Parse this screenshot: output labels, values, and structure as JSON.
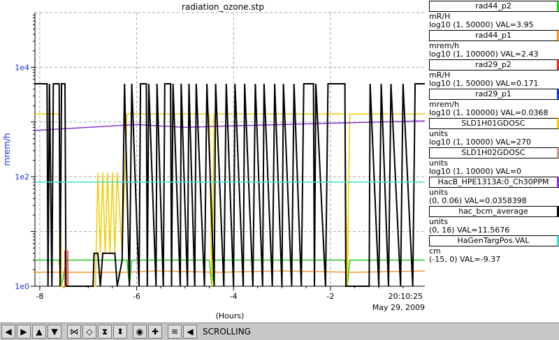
{
  "chart_data": {
    "type": "line",
    "title": "radiation_ozone.stp",
    "ylabel": "mrem/h",
    "xlabel": "(Hours)",
    "y_scale": "log",
    "ylim": [
      1,
      100000
    ],
    "xlim": [
      -8.1,
      -0.05
    ],
    "x_ticks": [
      -8,
      -6,
      -4,
      -2
    ],
    "y_ticks": [
      {
        "v": 1,
        "label": "1e0"
      },
      {
        "v": 100,
        "label": "1e2"
      },
      {
        "v": 10000,
        "label": "1e4"
      }
    ],
    "x_end_time": "20:10:25",
    "x_end_date": "May 29, 2009",
    "grid": true,
    "series": [
      {
        "name": "rad44_p2",
        "color": "#22cc22",
        "points": [
          [
            -8.1,
            3
          ],
          [
            -7.6,
            3
          ],
          [
            -7.55,
            1
          ],
          [
            -7.45,
            3
          ],
          [
            -6.2,
            3
          ],
          [
            -6.15,
            1
          ],
          [
            -6.1,
            3
          ],
          [
            -4.5,
            3
          ],
          [
            -4.45,
            1
          ],
          [
            -4.4,
            3
          ],
          [
            -1.7,
            3
          ],
          [
            -1.65,
            1
          ],
          [
            -1.6,
            3
          ],
          [
            -0.05,
            3
          ]
        ]
      },
      {
        "name": "rad44_p1",
        "color": "#ee9933",
        "points": [
          [
            -8.1,
            1.8
          ],
          [
            -7.5,
            1.8
          ],
          [
            -6.2,
            1.8
          ],
          [
            -5.6,
            1.9
          ],
          [
            -4.3,
            1.8
          ],
          [
            -3.0,
            1.9
          ],
          [
            -1.5,
            1.8
          ],
          [
            -0.05,
            1.9
          ]
        ]
      },
      {
        "name": "rad29_p2",
        "color": "#ee2222",
        "points": [
          [
            -7.48,
            4.5
          ],
          [
            -7.48,
            1
          ],
          [
            -7.42,
            1
          ],
          [
            -7.42,
            4.5
          ]
        ]
      },
      {
        "name": "rad29_p1",
        "color": "#1a2ee0",
        "points": []
      },
      {
        "name": "SLD1H01GDOSC",
        "color": "#f5cc00",
        "points": [
          [
            -8.1,
            1400
          ],
          [
            -7.6,
            1400
          ],
          [
            -7.55,
            1
          ],
          [
            -7.45,
            1
          ],
          [
            -6.85,
            1
          ],
          [
            -6.8,
            120
          ],
          [
            -6.75,
            4
          ],
          [
            -6.7,
            120
          ],
          [
            -6.65,
            4
          ],
          [
            -6.6,
            120
          ],
          [
            -6.55,
            4
          ],
          [
            -6.5,
            120
          ],
          [
            -6.45,
            4
          ],
          [
            -6.4,
            120
          ],
          [
            -6.3,
            4
          ],
          [
            -6.2,
            1400
          ],
          [
            -4.5,
            1400
          ],
          [
            -4.45,
            1
          ],
          [
            -4.4,
            1400
          ],
          [
            -1.7,
            1400
          ],
          [
            -1.65,
            1
          ],
          [
            -1.6,
            1400
          ],
          [
            -0.05,
            1400
          ]
        ]
      },
      {
        "name": "SLD1H02GDOSC",
        "color": "#c09a90",
        "points": []
      },
      {
        "name": "HacB_HPE1313A:0_Ch30PPM",
        "color": "#8833dd",
        "points": [
          [
            -8.1,
            700
          ],
          [
            -7.0,
            800
          ],
          [
            -6.0,
            900
          ],
          [
            -5.0,
            800
          ],
          [
            -4.0,
            850
          ],
          [
            -3.0,
            900
          ],
          [
            -2.0,
            950
          ],
          [
            -1.0,
            1000
          ],
          [
            -0.05,
            1050
          ]
        ]
      },
      {
        "name": "hac_bcm_average",
        "color": "#000000",
        "points": [
          [
            -8.1,
            5000
          ],
          [
            -7.85,
            5000
          ],
          [
            -7.83,
            1
          ],
          [
            -7.8,
            5000
          ],
          [
            -7.75,
            1
          ],
          [
            -7.72,
            5000
          ],
          [
            -7.6,
            5000
          ],
          [
            -7.58,
            1
          ],
          [
            -7.55,
            5000
          ],
          [
            -7.48,
            5000
          ],
          [
            -7.46,
            1
          ],
          [
            -6.9,
            1
          ],
          [
            -6.88,
            4
          ],
          [
            -6.8,
            4
          ],
          [
            -6.75,
            1
          ],
          [
            -6.7,
            4
          ],
          [
            -6.45,
            4
          ],
          [
            -6.4,
            1
          ],
          [
            -6.3,
            3
          ],
          [
            -6.25,
            5000
          ],
          [
            -6.15,
            1
          ],
          [
            -6.1,
            5000
          ],
          [
            -5.95,
            1
          ],
          [
            -5.92,
            5000
          ],
          [
            -5.8,
            5000
          ],
          [
            -5.78,
            1
          ],
          [
            -5.75,
            5000
          ],
          [
            -5.6,
            1
          ],
          [
            -5.58,
            5000
          ],
          [
            -5.45,
            1
          ],
          [
            -5.42,
            5000
          ],
          [
            -5.3,
            5000
          ],
          [
            -5.28,
            1
          ],
          [
            -5.25,
            5000
          ],
          [
            -5.1,
            1
          ],
          [
            -5.08,
            5000
          ],
          [
            -4.95,
            1
          ],
          [
            -4.92,
            5000
          ],
          [
            -4.8,
            1
          ],
          [
            -4.77,
            5000
          ],
          [
            -4.6,
            1
          ],
          [
            -4.55,
            5000
          ],
          [
            -4.4,
            1
          ],
          [
            -4.37,
            5000
          ],
          [
            -4.2,
            1
          ],
          [
            -4.15,
            5000
          ],
          [
            -4.0,
            1
          ],
          [
            -3.97,
            5000
          ],
          [
            -3.8,
            1
          ],
          [
            -3.77,
            5000
          ],
          [
            -3.6,
            1
          ],
          [
            -3.55,
            5000
          ],
          [
            -3.4,
            1
          ],
          [
            -3.37,
            5000
          ],
          [
            -3.2,
            1
          ],
          [
            -3.15,
            5000
          ],
          [
            -3.0,
            1
          ],
          [
            -2.97,
            5000
          ],
          [
            -2.8,
            1
          ],
          [
            -2.75,
            5000
          ],
          [
            -2.6,
            1
          ],
          [
            -2.55,
            5000
          ],
          [
            -2.35,
            5000
          ],
          [
            -2.33,
            1
          ],
          [
            -2.3,
            5000
          ],
          [
            -2.1,
            1
          ],
          [
            -2.05,
            5000
          ],
          [
            -1.7,
            5000
          ],
          [
            -1.68,
            1
          ],
          [
            -1.2,
            1
          ],
          [
            -1.18,
            5000
          ],
          [
            -1.0,
            1
          ],
          [
            -0.95,
            5000
          ],
          [
            -0.8,
            1
          ],
          [
            -0.75,
            5000
          ],
          [
            -0.55,
            1
          ],
          [
            -0.5,
            5000
          ],
          [
            -0.3,
            1
          ],
          [
            -0.25,
            5000
          ],
          [
            -0.05,
            5000
          ]
        ]
      },
      {
        "name": "HaGenTargPos.VAL",
        "color": "#44ddcc",
        "points": [
          [
            -8.1,
            80
          ],
          [
            -0.05,
            80
          ]
        ]
      }
    ]
  },
  "legend": [
    {
      "name": "rad44_p2",
      "color": "#22cc22",
      "units": "mR/H",
      "range": "log10 (1, 50000) VAL=3.95"
    },
    {
      "name": "rad44_p1",
      "color": "#ee9933",
      "units": "mrem/h",
      "range": "log10 (1, 100000) VAL=2.43"
    },
    {
      "name": "rad29_p2",
      "color": "#ee2222",
      "units": "mR/H",
      "range": "log10 (1, 50000) VAL=0.171"
    },
    {
      "name": "rad29_p1",
      "color": "#1a2ee0",
      "units": "mrem/h",
      "range": "log10 (1, 100000) VAL=0.0368"
    },
    {
      "name": "SLD1H01GDOSC",
      "color": "#f5cc00",
      "units": "units",
      "range": "log10 (1, 10000) VAL=270"
    },
    {
      "name": "SLD1H02GDOSC",
      "color": "#c09a90",
      "units": "units",
      "range": "log10 (1, 10000) VAL=0"
    },
    {
      "name": "HacB_HPE1313A:0_Ch30PPM",
      "color": "#8833dd",
      "units": "units",
      "range": "(0, 0.06) VAL=0.0358398"
    },
    {
      "name": "hac_bcm_average",
      "color": "#000000",
      "units": "units",
      "range": "(0, 16) VAL=11.5676"
    },
    {
      "name": "HaGenTargPos.VAL",
      "color": "#44ddcc",
      "units": "cm",
      "range": "(-15, 0) VAL=-9.37"
    }
  ],
  "axis_color": "#1a2ee0",
  "toolbar": {
    "status": "SCROLLING",
    "buttons": [
      {
        "name": "scroll-left-button",
        "glyph": "◀"
      },
      {
        "name": "scroll-right-button",
        "glyph": "▶"
      },
      {
        "name": "scroll-up-button",
        "glyph": "▲"
      },
      {
        "name": "scroll-down-button",
        "glyph": "▼"
      },
      {
        "name": "zoom-in-x-button",
        "glyph": "⋈"
      },
      {
        "name": "zoom-out-x-button",
        "glyph": "◇"
      },
      {
        "name": "zoom-in-y-button",
        "glyph": "⧗"
      },
      {
        "name": "zoom-out-y-button",
        "glyph": "⬍"
      },
      {
        "name": "auto-scale-button",
        "glyph": "◉"
      },
      {
        "name": "add-button",
        "glyph": "✚"
      },
      {
        "name": "config-button",
        "glyph": "≋"
      },
      {
        "name": "pause-button",
        "glyph": "◀"
      }
    ]
  }
}
